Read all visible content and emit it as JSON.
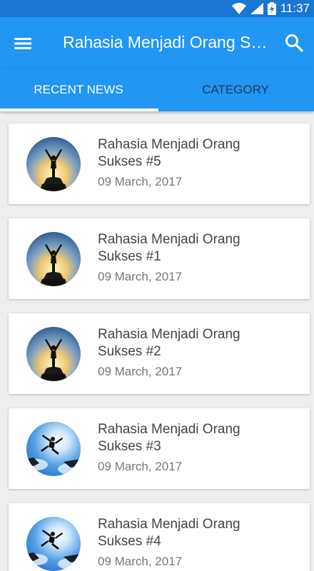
{
  "status": {
    "time": "11:37"
  },
  "appbar": {
    "title": "Rahasia Menjadi Orang Sukses",
    "menu_icon": "menu-icon",
    "search_icon": "search-icon"
  },
  "tabs": [
    {
      "label": "RECENT NEWS"
    },
    {
      "label": "CATEGORY"
    }
  ],
  "colors": {
    "primary": "#2196f3",
    "status": "#1976d2",
    "inactive_tab": "#1b3b5a"
  },
  "news": [
    {
      "title": "Rahasia Menjadi Orang Sukses #5",
      "date": "09 March, 2017",
      "image": "summit-silhouette"
    },
    {
      "title": "Rahasia Menjadi Orang Sukses #1",
      "date": "09 March, 2017",
      "image": "summit-silhouette"
    },
    {
      "title": "Rahasia Menjadi Orang Sukses #2",
      "date": "09 March, 2017",
      "image": "summit-silhouette"
    },
    {
      "title": "Rahasia Menjadi Orang Sukses #3",
      "date": "09 March, 2017",
      "image": "jumping-sky"
    },
    {
      "title": "Rahasia Menjadi Orang Sukses #4",
      "date": "09 March, 2017",
      "image": "jumping-sky"
    }
  ]
}
